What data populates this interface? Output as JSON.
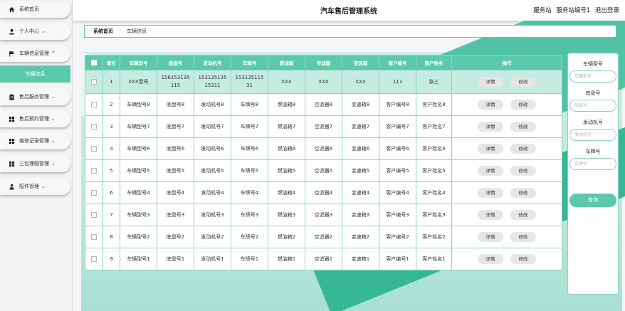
{
  "header": {
    "title": "汽车售后管理系统",
    "station_role": "服务站",
    "station_id": "服务站编号1",
    "logout": "退出登录"
  },
  "sidebar": {
    "items": [
      {
        "label": "系统首页",
        "icon": "home-icon",
        "chevron": ""
      },
      {
        "label": "个人中心",
        "icon": "user-icon",
        "chevron": "⌄"
      },
      {
        "label": "车辆信息管理",
        "icon": "flag-icon",
        "chevron": "^"
      },
      {
        "label": "车辆信息",
        "icon": "",
        "chevron": ""
      },
      {
        "label": "售后服务管理",
        "icon": "clipboard-icon",
        "chevron": "⌄"
      },
      {
        "label": "售后预约管理",
        "icon": "grid-icon",
        "chevron": "⌄"
      },
      {
        "label": "维修记录管理",
        "icon": "grid-icon",
        "chevron": "⌄"
      },
      {
        "label": "三包理赔管理",
        "icon": "grid-icon",
        "chevron": "⌄"
      },
      {
        "label": "配件管理",
        "icon": "person-icon",
        "chevron": "⌄"
      }
    ]
  },
  "breadcrumb": {
    "home": "系统首页",
    "separator": "⋮",
    "current": "车辆信息"
  },
  "table": {
    "columns": [
      "索引",
      "车辆型号",
      "底盘号",
      "发动机号",
      "车牌号",
      "燃油箱",
      "空滤器",
      "变速箱",
      "客户编号",
      "客户姓名",
      "操作"
    ],
    "detail_label": "详情",
    "edit_label": "修改",
    "rows": [
      {
        "index": "1",
        "model": "XXX型号",
        "chassis": "156153135115",
        "engine": "15313513515311",
        "plate": "15313511531",
        "fuel": "XXX",
        "filter": "XXX",
        "gearbox": "XXX",
        "cust_no": "111",
        "cust_name": "张三"
      },
      {
        "index": "2",
        "model": "车辆型号8",
        "chassis": "底盘号8",
        "engine": "发动机号8",
        "plate": "车牌号8",
        "fuel": "燃油箱8",
        "filter": "空滤器8",
        "gearbox": "变速箱8",
        "cust_no": "客户编号8",
        "cust_name": "客户姓名8"
      },
      {
        "index": "3",
        "model": "车辆型号7",
        "chassis": "底盘号7",
        "engine": "发动机号7",
        "plate": "车牌号7",
        "fuel": "燃油箱7",
        "filter": "空滤器7",
        "gearbox": "变速箱7",
        "cust_no": "客户编号7",
        "cust_name": "客户姓名7"
      },
      {
        "index": "4",
        "model": "车辆型号6",
        "chassis": "底盘号6",
        "engine": "发动机号6",
        "plate": "车牌号6",
        "fuel": "燃油箱6",
        "filter": "空滤器6",
        "gearbox": "变速箱6",
        "cust_no": "客户编号6",
        "cust_name": "客户姓名6"
      },
      {
        "index": "5",
        "model": "车辆型号5",
        "chassis": "底盘号5",
        "engine": "发动机号5",
        "plate": "车牌号5",
        "fuel": "燃油箱5",
        "filter": "空滤器5",
        "gearbox": "变速箱5",
        "cust_no": "客户编号5",
        "cust_name": "客户姓名5"
      },
      {
        "index": "6",
        "model": "车辆型号4",
        "chassis": "底盘号4",
        "engine": "发动机号4",
        "plate": "车牌号4",
        "fuel": "燃油箱4",
        "filter": "空滤器4",
        "gearbox": "变速箱4",
        "cust_no": "客户编号4",
        "cust_name": "客户姓名4"
      },
      {
        "index": "7",
        "model": "车辆型号3",
        "chassis": "底盘号3",
        "engine": "发动机号3",
        "plate": "车牌号3",
        "fuel": "燃油箱3",
        "filter": "空滤器3",
        "gearbox": "变速箱3",
        "cust_no": "客户编号3",
        "cust_name": "客户姓名3"
      },
      {
        "index": "8",
        "model": "车辆型号2",
        "chassis": "底盘号2",
        "engine": "发动机号2",
        "plate": "车牌号2",
        "fuel": "燃油箱2",
        "filter": "空滤器2",
        "gearbox": "变速箱2",
        "cust_no": "客户编号2",
        "cust_name": "客户姓名2"
      },
      {
        "index": "9",
        "model": "车辆型号1",
        "chassis": "底盘号1",
        "engine": "发动机号1",
        "plate": "车牌号1",
        "fuel": "燃油箱1",
        "filter": "空滤器1",
        "gearbox": "变速箱1",
        "cust_no": "客户编号1",
        "cust_name": "客户姓名1"
      }
    ]
  },
  "search": {
    "fields": [
      {
        "label": "车辆型号",
        "placeholder": "车辆型号"
      },
      {
        "label": "底盘号",
        "placeholder": "底盘号"
      },
      {
        "label": "发动机号",
        "placeholder": "发动机号"
      },
      {
        "label": "车牌号",
        "placeholder": "车牌号"
      }
    ],
    "query_label": "查询"
  },
  "colors": {
    "accent": "#5cc9ab",
    "highlight_row": "#c6ece0",
    "border": "#8fd2bf"
  }
}
